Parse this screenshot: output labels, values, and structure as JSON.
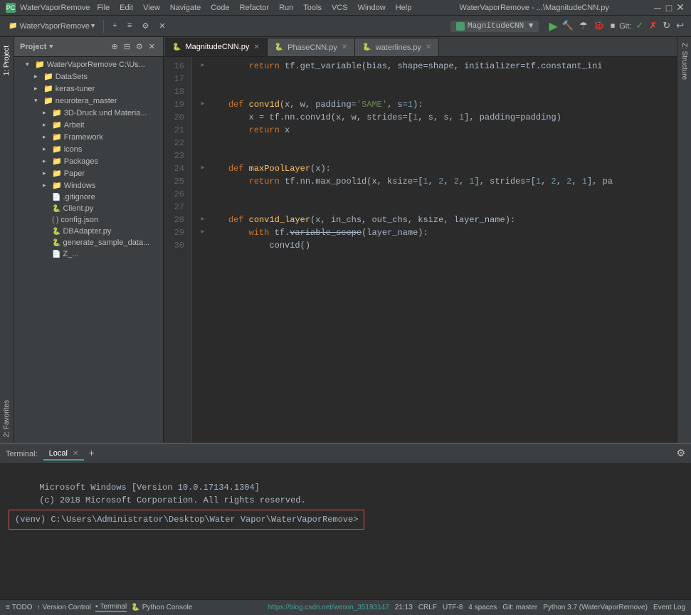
{
  "titlebar": {
    "app_icon": "PC",
    "title": "WaterVaporRemove",
    "window_title": "WaterVaporRemove - ...\\MagnitudeCNN.py",
    "menus": [
      "File",
      "Edit",
      "View",
      "Navigate",
      "Code",
      "Refactor",
      "Run",
      "Tools",
      "VCS",
      "Window",
      "Help"
    ]
  },
  "toolbar": {
    "project_label": "WaterVaporRemove",
    "run_config": "MagnitudeCNN ▼",
    "git_label": "Git:",
    "icons": {
      "play": "▶",
      "build": "🔨",
      "refresh": "↺",
      "pause": "⏸",
      "stop": "⏹",
      "git_check": "✓",
      "git_x": "✗",
      "git_refresh": "↻",
      "git_undo": "↩"
    }
  },
  "project_panel": {
    "title": "Project",
    "root": "WaterVaporRemove C:\\Us...",
    "items": [
      {
        "label": "DataSets",
        "type": "folder",
        "indent": 2,
        "expanded": false
      },
      {
        "label": "keras-tuner",
        "type": "folder",
        "indent": 2,
        "expanded": false
      },
      {
        "label": "neurotera_master",
        "type": "folder",
        "indent": 2,
        "expanded": true
      },
      {
        "label": "3D-Druck und Materia...",
        "type": "folder",
        "indent": 3,
        "expanded": false
      },
      {
        "label": "Arbeit",
        "type": "folder",
        "indent": 3,
        "expanded": false
      },
      {
        "label": "Framework",
        "type": "folder",
        "indent": 3,
        "expanded": false
      },
      {
        "label": "icons",
        "type": "folder",
        "indent": 3,
        "expanded": false
      },
      {
        "label": "Packages",
        "type": "folder",
        "indent": 3,
        "expanded": false
      },
      {
        "label": "Paper",
        "type": "folder",
        "indent": 3,
        "expanded": false
      },
      {
        "label": "Windows",
        "type": "folder",
        "indent": 3,
        "expanded": false
      },
      {
        "label": ".gitignore",
        "type": "file",
        "indent": 3
      },
      {
        "label": "Client.py",
        "type": "pyfile",
        "indent": 3
      },
      {
        "label": "config.json",
        "type": "jsonfile",
        "indent": 3
      },
      {
        "label": "DBAdapter.py",
        "type": "pyfile",
        "indent": 3
      },
      {
        "label": "generate_sample_data...",
        "type": "pyfile",
        "indent": 3
      },
      {
        "label": "Z_...",
        "type": "file",
        "indent": 3
      }
    ]
  },
  "editor": {
    "tabs": [
      {
        "label": "MagnitudeCNN.py",
        "active": true,
        "modified": false
      },
      {
        "label": "PhaseCNN.py",
        "active": false,
        "modified": false
      },
      {
        "label": "waterlines.py",
        "active": false,
        "modified": false
      }
    ],
    "lines": [
      {
        "num": 16,
        "indent": "",
        "fold": "▸",
        "code": "        return tf.get_variable(<span class='var'>bias</span>, shape=shape, initializer=tf.constant_ini"
      },
      {
        "num": 17,
        "indent": "",
        "fold": " ",
        "code": ""
      },
      {
        "num": 18,
        "indent": "",
        "fold": " ",
        "code": ""
      },
      {
        "num": 19,
        "indent": "",
        "fold": "▸",
        "code": "    <span class='kw'>def</span> <span class='fn'>conv1d</span>(x, w, padding=<span class='str'>'SAME'</span>, s=<span class='num'>1</span>):"
      },
      {
        "num": 20,
        "indent": "",
        "fold": " ",
        "code": "        x = tf.nn.conv1d(x, w, strides=[<span class='num'>1</span>, s, s, <span class='num'>1</span>], padding=padding)"
      },
      {
        "num": 21,
        "indent": "",
        "fold": " ",
        "code": "        <span class='kw'>return</span> x"
      },
      {
        "num": 22,
        "indent": "",
        "fold": " ",
        "code": ""
      },
      {
        "num": 23,
        "indent": "",
        "fold": " ",
        "code": ""
      },
      {
        "num": 24,
        "indent": "",
        "fold": "▸",
        "code": "    <span class='kw'>def</span> <span class='fn'>maxPoolLayer</span>(x):"
      },
      {
        "num": 25,
        "indent": "",
        "fold": " ",
        "code": "        <span class='kw'>return</span> tf.nn.max_pool1d(x, ksize=[<span class='num'>1</span>, <span class='num'>2</span>, <span class='num'>2</span>, <span class='num'>1</span>], strides=[<span class='num'>1</span>, <span class='num'>2</span>, <span class='num'>2</span>, <span class='num'>1</span>], pa"
      },
      {
        "num": 26,
        "indent": "",
        "fold": " ",
        "code": ""
      },
      {
        "num": 27,
        "indent": "",
        "fold": " ",
        "code": ""
      },
      {
        "num": 28,
        "indent": "",
        "fold": "▸",
        "code": "    <span class='kw'>def</span> <span class='fn'>conv1d_layer</span>(x, in_chs, out_chs, ksize, layer_name):"
      },
      {
        "num": 29,
        "indent": "",
        "fold": "▸",
        "code": "        <span class='kw'>with</span> tf.variable_scope(layer_name):"
      },
      {
        "num": 30,
        "indent": "",
        "fold": " ",
        "code": "            conv1d()"
      }
    ]
  },
  "terminal": {
    "tabs": [
      {
        "label": "Local",
        "active": true
      },
      {
        "label": "+",
        "is_add": true
      }
    ],
    "tab_label": "Terminal:",
    "lines": [
      "Microsoft Windows [Version 10.0.17134.1304]",
      "(c) 2018 Microsoft Corporation. All rights reserved.",
      ""
    ],
    "prompt": "(venv) C:\\Users\\Administrator\\Desktop\\Water Vapor\\WaterVaporRemove>"
  },
  "statusbar": {
    "left_items": [
      {
        "label": "TODO",
        "icon": "≡"
      },
      {
        "label": "Version Control",
        "icon": "↑"
      },
      {
        "label": "Terminal",
        "icon": "■",
        "active": true
      },
      {
        "label": "Python Console",
        "icon": "🐍"
      }
    ],
    "right_items": [
      {
        "label": "21:13"
      },
      {
        "label": "CRLF"
      },
      {
        "label": "UTF-8"
      },
      {
        "label": "4 spaces"
      },
      {
        "label": "Git: master"
      },
      {
        "label": "Python 3.7 (WaterVaporRemove)"
      },
      {
        "label": "https://blog.csdn.net/weixin_35193147"
      },
      {
        "label": "Event Log"
      }
    ]
  },
  "side_tabs": {
    "left": [
      "1: Project",
      "2: Favorites"
    ],
    "right": [
      "Z: Structure"
    ]
  }
}
